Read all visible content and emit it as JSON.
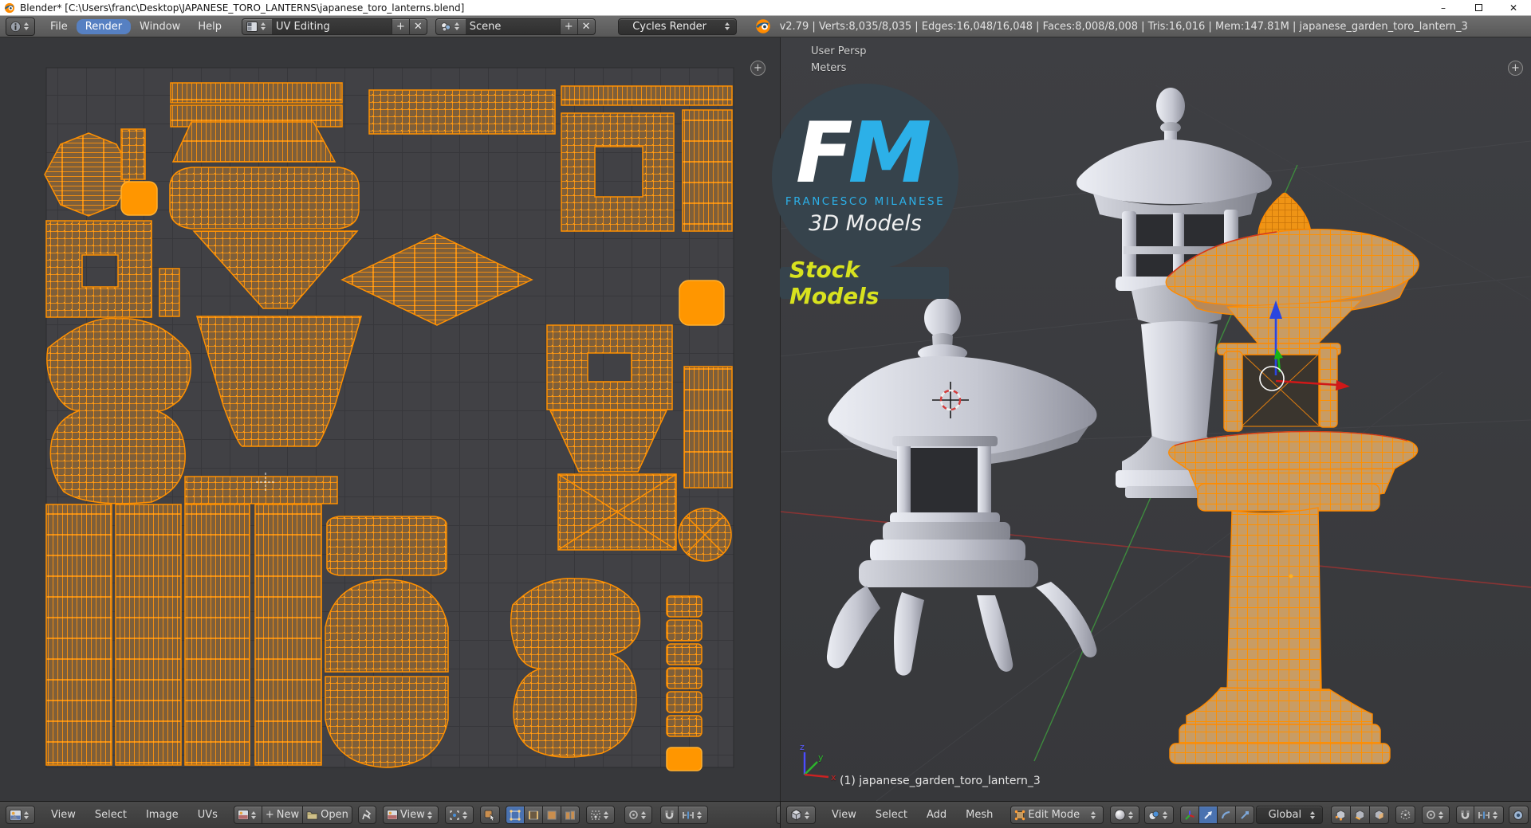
{
  "window": {
    "title": "Blender* [C:\\Users\\franc\\Desktop\\JAPANESE_TORO_LANTERNS\\japanese_toro_lanterns.blend]",
    "minimize_glyph": "–",
    "close_glyph": "✕"
  },
  "infobar": {
    "menus": [
      {
        "label": "File"
      },
      {
        "label": "Render"
      },
      {
        "label": "Window"
      },
      {
        "label": "Help"
      }
    ],
    "layout_value": "UV Editing",
    "scene_value": "Scene",
    "engine_value": "Cycles Render",
    "plus_glyph": "+",
    "x_glyph": "✕",
    "stats": "v2.79 | Verts:8,035/8,035 | Edges:16,048/16,048 | Faces:8,008/8,008 | Tris:16,016 | Mem:147.81M | japanese_garden_toro_lantern_3"
  },
  "uv_editor": {
    "header": {
      "menus": [
        "View",
        "Select",
        "Image",
        "UVs"
      ],
      "new_label": "New",
      "open_label": "Open",
      "view_label": "View",
      "plus_glyph": "+"
    },
    "region_plus_glyph": "+"
  },
  "viewport3d": {
    "view_name": "User Persp",
    "units": "Meters",
    "object_info": "(1) japanese_garden_toro_lantern_3",
    "axis": {
      "x": "x",
      "y": "y",
      "z": "z"
    },
    "region_plus_glyph": "+",
    "header": {
      "menus": [
        "View",
        "Select",
        "Add",
        "Mesh"
      ],
      "mode_value": "Edit Mode",
      "orientation_value": "Global"
    }
  },
  "logo": {
    "initial_f": "F",
    "initial_m": "M",
    "name": "FRANCESCO MILANESE",
    "tagline": "3D Models",
    "badge": "Stock Models"
  },
  "colors": {
    "selection_orange": "#ff9000",
    "render_active_blue": "#5680c2",
    "logo_cyan": "#2cb0e8",
    "badge_yellow": "#d8e21f"
  }
}
